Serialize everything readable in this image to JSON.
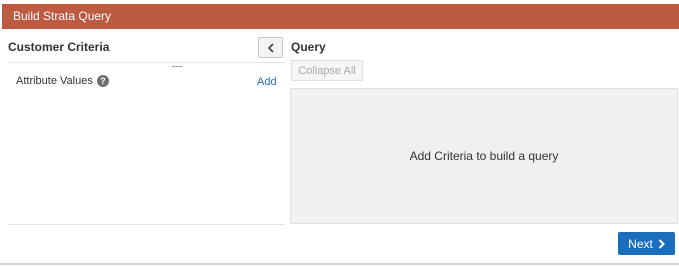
{
  "dialog": {
    "title": "Build Strata Query"
  },
  "left_panel": {
    "header": "Customer Criteria",
    "attribute": {
      "label": "Attribute Values",
      "help": "?",
      "add_label": "Add"
    }
  },
  "right_panel": {
    "header": "Query",
    "collapse_all_label": "Collapse All",
    "empty_message": "Add Criteria to build a query"
  },
  "footer": {
    "next_label": "Next"
  },
  "colors": {
    "titlebar": "#bc5a42",
    "primary": "#1a6fbd",
    "query_bg": "#f0f0f1"
  },
  "icons": {
    "collapse": "chevron-left-icon",
    "next": "chevron-right-icon",
    "help": "help-icon"
  }
}
